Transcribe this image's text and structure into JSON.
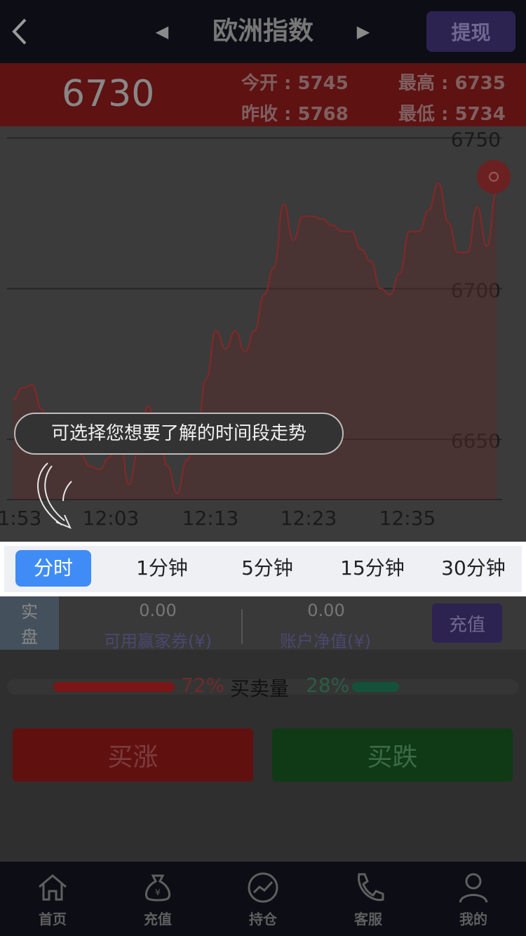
{
  "header": {
    "title": "欧洲指数",
    "withdraw_label": "提现",
    "prev_glyph": "◀",
    "next_glyph": "▶"
  },
  "quote": {
    "price": "6730",
    "open_label": "今开 : 5745",
    "prev_close_label": "昨收 : 5768",
    "high_label": "最高 : 6735",
    "low_label": "最低 : 5734"
  },
  "chart_data": {
    "type": "line",
    "y_ticks": [
      "6750",
      "6700",
      "6650"
    ],
    "x_ticks": [
      "1:53",
      "12:03",
      "12:13",
      "12:23",
      "12:35"
    ],
    "ylim": [
      6630,
      6752
    ],
    "x": [
      0,
      1,
      2,
      3,
      4,
      5,
      6,
      7,
      8,
      9,
      10,
      11,
      12,
      13,
      14,
      15,
      16,
      17,
      18,
      19,
      20,
      21,
      22,
      23,
      24,
      25,
      26,
      27,
      28,
      29,
      30,
      31,
      32,
      33,
      34,
      35,
      36,
      37,
      38,
      39,
      40,
      41,
      42,
      43,
      44,
      45,
      46,
      47,
      48,
      49,
      50
    ],
    "values": [
      6663,
      6667,
      6668,
      6660,
      6648,
      6658,
      6652,
      6645,
      6641,
      6640,
      6644,
      6653,
      6635,
      6646,
      6661,
      6653,
      6641,
      6632,
      6643,
      6651,
      6670,
      6686,
      6680,
      6686,
      6679,
      6686,
      6698,
      6707,
      6728,
      6716,
      6724,
      6724,
      6723,
      6721,
      6719,
      6719,
      6713,
      6709,
      6700,
      6698,
      6705,
      6719,
      6719,
      6726,
      6735,
      6722,
      6712,
      6712,
      6727,
      6714,
      6732
    ],
    "colors": {
      "line": "#7a2a2a",
      "fill": "#5a2b2b",
      "grid": "#262626"
    }
  },
  "tip": {
    "text": "可选择您想要了解的时间段走势"
  },
  "tabs": [
    {
      "label": "分时"
    },
    {
      "label": "1分钟"
    },
    {
      "label": "5分钟"
    },
    {
      "label": "15分钟"
    },
    {
      "label": "30分钟"
    }
  ],
  "account": {
    "mode_line1": "实",
    "mode_line2": "盘",
    "voucher_value": "0.00",
    "voucher_label": "可用赢家券(¥)",
    "equity_value": "0.00",
    "equity_label": "账户净值(¥)",
    "recharge_label": "充值"
  },
  "volume": {
    "buy_pct": "72%",
    "label": "买卖量",
    "sell_pct": "28%",
    "buy_fraction": 0.72,
    "sell_fraction": 0.28
  },
  "actions": {
    "buy_up": "买涨",
    "buy_down": "买跌"
  },
  "nav": [
    {
      "label": "首页",
      "icon": "home-icon"
    },
    {
      "label": "充值",
      "icon": "money-bag-icon"
    },
    {
      "label": "持仓",
      "icon": "trend-icon"
    },
    {
      "label": "客服",
      "icon": "phone-icon"
    },
    {
      "label": "我的",
      "icon": "user-icon"
    }
  ]
}
